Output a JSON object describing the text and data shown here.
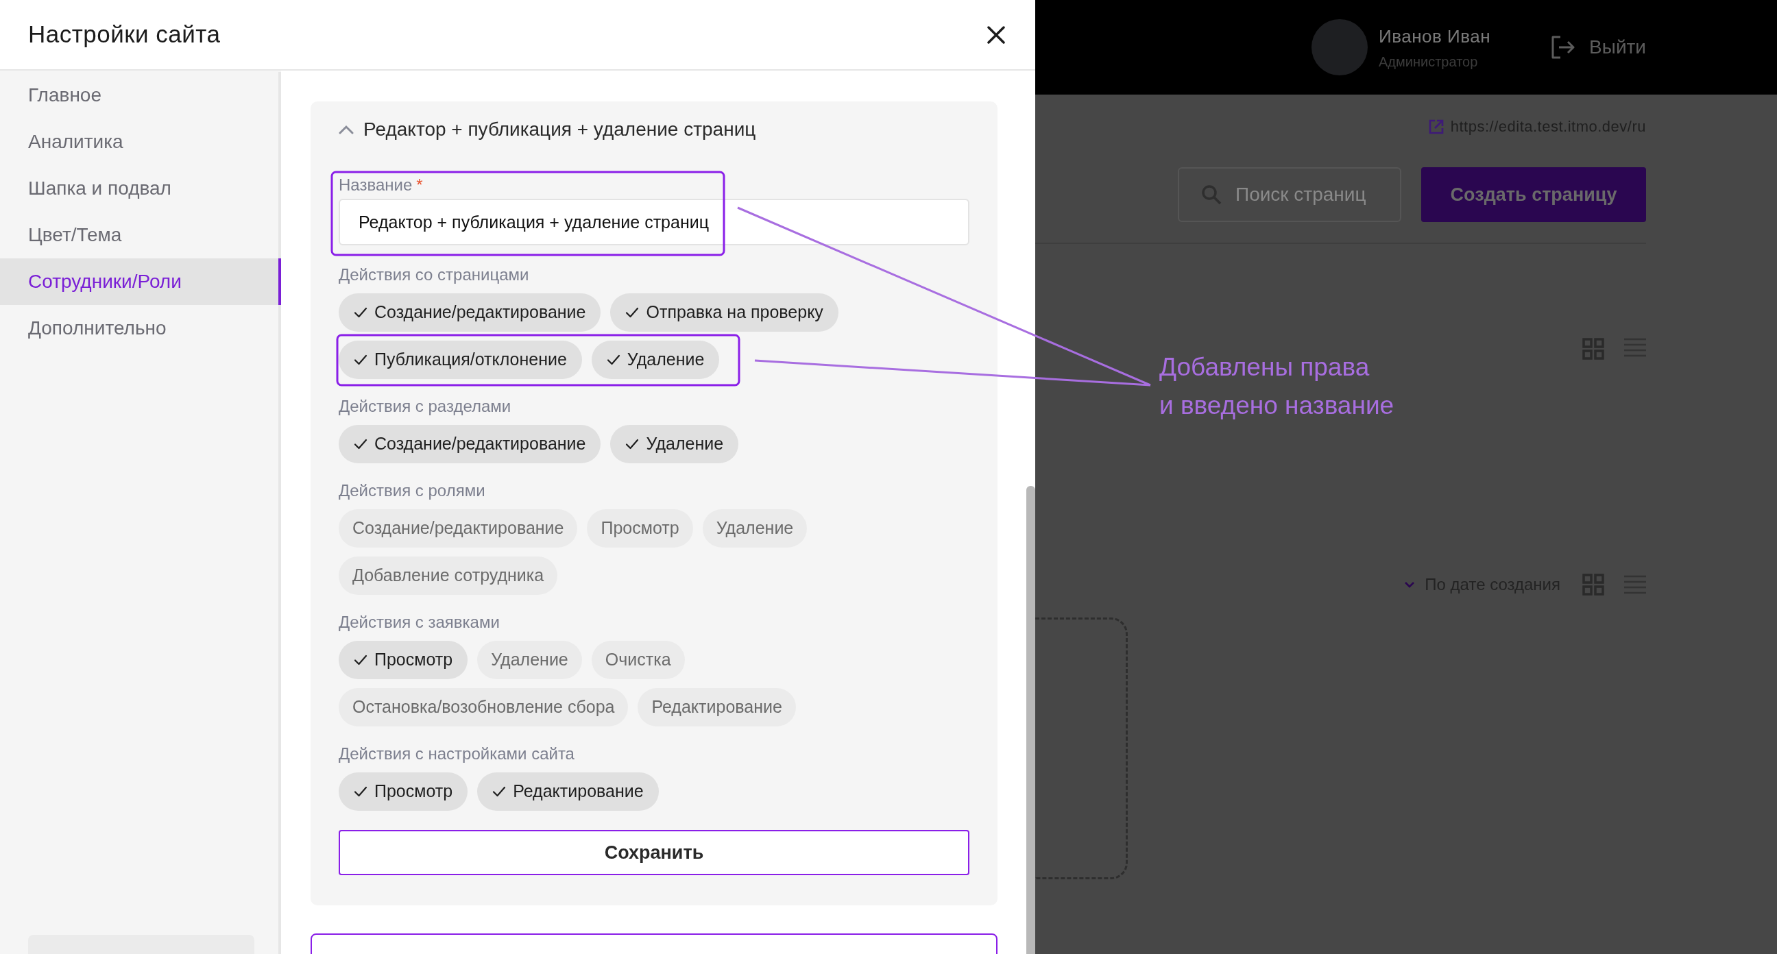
{
  "dialog": {
    "title": "Настройки сайта"
  },
  "sidebar": {
    "items": [
      {
        "label": "Главное",
        "selected": false
      },
      {
        "label": "Аналитика",
        "selected": false
      },
      {
        "label": "Шапка и подвал",
        "selected": false
      },
      {
        "label": "Цвет/Тема",
        "selected": false
      },
      {
        "label": "Сотрудники/Роли",
        "selected": true
      },
      {
        "label": "Дополнительно",
        "selected": false
      }
    ]
  },
  "role": {
    "title": "Редактор + публикация + удаление страниц",
    "expanded": true,
    "name_field": {
      "label": "Название",
      "required_mark": "*",
      "value": "Редактор + публикация + удаление страниц"
    },
    "groups": [
      {
        "label": "Действия со страницами",
        "permissions": [
          {
            "label": "Создание/редактирование",
            "checked": true
          },
          {
            "label": "Отправка на проверку",
            "checked": true
          },
          {
            "label": "Публикация/отклонение",
            "checked": true
          },
          {
            "label": "Удаление",
            "checked": true
          }
        ]
      },
      {
        "label": "Действия с разделами",
        "permissions": [
          {
            "label": "Создание/редактирование",
            "checked": true
          },
          {
            "label": "Удаление",
            "checked": true
          }
        ]
      },
      {
        "label": "Действия с ролями",
        "permissions": [
          {
            "label": "Создание/редактирование",
            "checked": false
          },
          {
            "label": "Просмотр",
            "checked": false
          },
          {
            "label": "Удаление",
            "checked": false
          },
          {
            "label": "Добавление сотрудника",
            "checked": false
          }
        ]
      },
      {
        "label": "Действия с заявками",
        "permissions": [
          {
            "label": "Просмотр",
            "checked": true
          },
          {
            "label": "Удаление",
            "checked": false
          },
          {
            "label": "Очистка",
            "checked": false
          },
          {
            "label": "Остановка/возобновление сбора",
            "checked": false
          },
          {
            "label": "Редактирование",
            "checked": false
          }
        ]
      },
      {
        "label": "Действия с настройками сайта",
        "permissions": [
          {
            "label": "Просмотр",
            "checked": true
          },
          {
            "label": "Редактирование",
            "checked": true
          }
        ]
      }
    ],
    "save_button": "Сохранить"
  },
  "header": {
    "user_name": "Иванов Иван",
    "user_role": "Администратор",
    "logout": "Выйти"
  },
  "site_link": "https://edita.test.itmo.dev/ru",
  "search": {
    "placeholder": "Поиск страниц"
  },
  "create_button": "Создать страницу",
  "sort": {
    "label": "По дате создания"
  },
  "annotation": {
    "text": "Добавлены права\nи введено название"
  }
}
